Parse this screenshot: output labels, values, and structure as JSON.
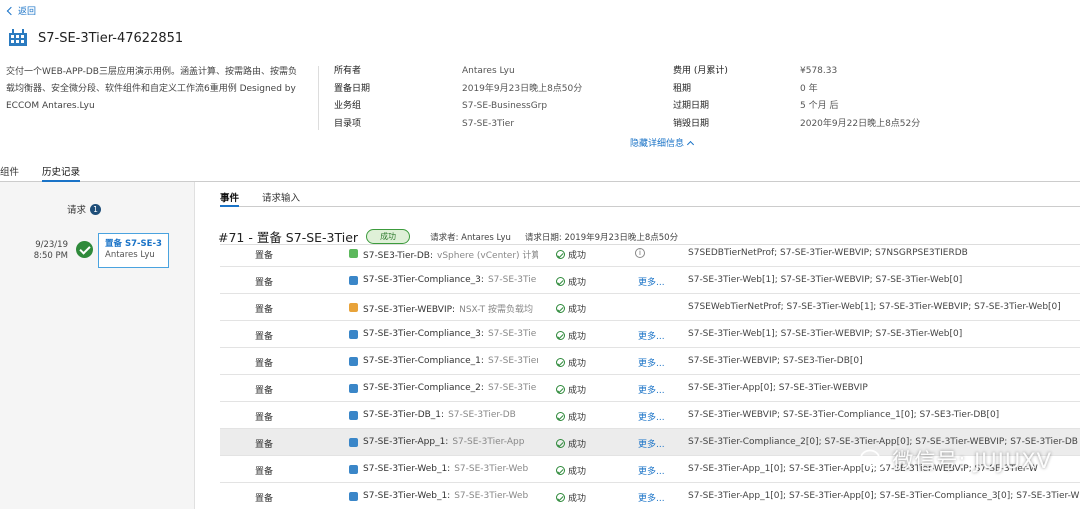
{
  "header": {
    "back_label": "返回",
    "title": "S7-SE-3Tier-47622851",
    "description": "交付一个WEB-APP-DB三层应用演示用例。涵盖计算、按需路由、按需负载均衡器、安全微分段、软件组件和自定义工作流6重用例 Designed by ECCOM Antares.Lyu"
  },
  "details": {
    "col1": [
      {
        "k": "所有者",
        "v": "Antares Lyu"
      },
      {
        "k": "置备日期",
        "v": "2019年9月23日晚上8点50分"
      },
      {
        "k": "业务组",
        "v": "S7-SE-BusinessGrp"
      },
      {
        "k": "目录项",
        "v": "S7-SE-3Tier"
      }
    ],
    "col2": [
      {
        "k": "费用 (月累计)",
        "v": "¥578.33"
      },
      {
        "k": "租期",
        "v": "0 年"
      },
      {
        "k": "过期日期",
        "v": "5 个月 后"
      },
      {
        "k": "销毁日期",
        "v": "2020年9月22日晚上8点52分"
      }
    ],
    "hide_label": "隐藏详细信息"
  },
  "tabs": {
    "components": "组件",
    "history": "历史记录"
  },
  "history": {
    "request_label": "请求",
    "request_count": "1",
    "date": "9/23/19",
    "time": "8:50 PM",
    "card_title": "置备 S7-SE-3...",
    "card_user": "Antares Lyu"
  },
  "subtabs": {
    "events": "事件",
    "request_input": "请求输入"
  },
  "event": {
    "title": "#71 - 置备 S7-SE-3Tier",
    "status": "成功",
    "requester": "请求者: Antares Lyu",
    "request_date": "请求日期: 2019年9月23日晚上8点50分"
  },
  "rows": [
    {
      "action": "置备",
      "icon": "vm-green",
      "component": "S7-SE3-Tier-DB:",
      "sub": "vSphere (vCenter) 计算",
      "status": "成功",
      "extra": "info",
      "deps": "S7SEDBTierNetProf; S7-SE-3Tier-WEBVIP; S7NSGRPSE3TIERDB"
    },
    {
      "action": "置备",
      "icon": "vm-blue",
      "component": "S7-SE-3Tier-Compliance_3:",
      "sub": "S7-SE-3Tie",
      "status": "成功",
      "extra": "更多...",
      "deps": "S7-SE-3Tier-Web[1]; S7-SE-3Tier-WEBVIP; S7-SE-3Tier-Web[0]"
    },
    {
      "action": "置备",
      "icon": "lb-orange",
      "component": "S7-SE-3Tier-WEBVIP:",
      "sub": "NSX-T 按需负载均",
      "status": "成功",
      "extra": "",
      "deps": "S7SEWebTierNetProf; S7-SE-3Tier-Web[1]; S7-SE-3Tier-WEBVIP; S7-SE-3Tier-Web[0]"
    },
    {
      "action": "置备",
      "icon": "vm-blue",
      "component": "S7-SE-3Tier-Compliance_3:",
      "sub": "S7-SE-3Tie",
      "status": "成功",
      "extra": "更多...",
      "deps": "S7-SE-3Tier-Web[1]; S7-SE-3Tier-WEBVIP; S7-SE-3Tier-Web[0]"
    },
    {
      "action": "置备",
      "icon": "vm-blue",
      "component": "S7-SE-3Tier-Compliance_1:",
      "sub": "S7-SE-3Tier",
      "status": "成功",
      "extra": "更多...",
      "deps": "S7-SE-3Tier-WEBVIP; S7-SE3-Tier-DB[0]"
    },
    {
      "action": "置备",
      "icon": "vm-blue",
      "component": "S7-SE-3Tier-Compliance_2:",
      "sub": "S7-SE-3Tie",
      "status": "成功",
      "extra": "更多...",
      "deps": "S7-SE-3Tier-App[0]; S7-SE-3Tier-WEBVIP"
    },
    {
      "action": "置备",
      "icon": "vm-blue",
      "component": "S7-SE-3Tier-DB_1:",
      "sub": "S7-SE-3Tier-DB",
      "status": "成功",
      "extra": "更多...",
      "deps": "S7-SE-3Tier-WEBVIP; S7-SE-3Tier-Compliance_1[0]; S7-SE3-Tier-DB[0]"
    },
    {
      "action": "置备",
      "icon": "vm-blue",
      "component": "S7-SE-3Tier-App_1:",
      "sub": "S7-SE-3Tier-App",
      "status": "成功",
      "extra": "更多...",
      "deps": "S7-SE-3Tier-Compliance_2[0]; S7-SE-3Tier-App[0]; S7-SE-3Tier-WEBVIP; S7-SE-3Tier-DB",
      "highlight": true
    },
    {
      "action": "置备",
      "icon": "vm-blue",
      "component": "S7-SE-3Tier-Web_1:",
      "sub": "S7-SE-3Tier-Web",
      "status": "成功",
      "extra": "更多...",
      "deps": "S7-SE-3Tier-App_1[0]; S7-SE-3Tier-App[0]; S7-SE-3Tier-WEBVIP; S7-SE-3Tier-W"
    },
    {
      "action": "置备",
      "icon": "vm-blue",
      "component": "S7-SE-3Tier-Web_1:",
      "sub": "S7-SE-3Tier-Web",
      "status": "成功",
      "extra": "更多...",
      "deps": "S7-SE-3Tier-App_1[0]; S7-SE-3Tier-App[0]; S7-SE-3Tier-Compliance_3[0]; S7-SE-3Tier-W"
    }
  ],
  "watermark": "微信号: JUJUXV",
  "colors": {
    "accent": "#1a73c7",
    "success": "#2f8a3b",
    "badge_bg": "#dff0d8"
  }
}
